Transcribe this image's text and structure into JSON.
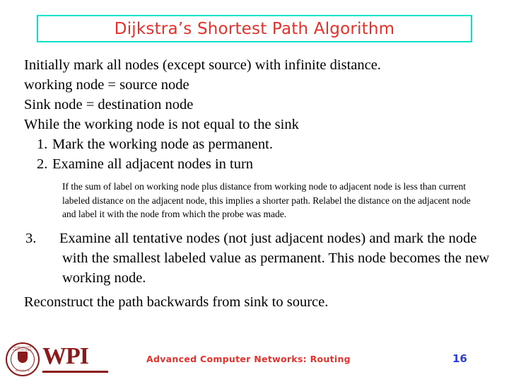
{
  "slide": {
    "title": "Dijkstra’s Shortest Path Algorithm",
    "lines": [
      "Initially mark all nodes (except source) with infinite distance.",
      "working node = source node",
      "Sink node  = destination node",
      "While the working node is not equal to the sink"
    ],
    "steps": [
      {
        "num": "1.",
        "text": "Mark the working node as permanent."
      },
      {
        "num": "2.",
        "text": "Examine all adjacent nodes in turn"
      }
    ],
    "note": "If the sum of label on working node plus distance from working node to adjacent node is less than current labeled distance on the adjacent node, this implies a shorter path. Relabel the distance on the adjacent node and label it with the node from which the probe was made.",
    "step3": {
      "num": "3.",
      "text": "Examine all tentative nodes (not just adjacent nodes) and mark the node with the smallest labeled value as permanent. This node becomes the new working node."
    },
    "closing": "Reconstruct the path backwards from sink to source."
  },
  "footer": {
    "text": "Advanced Computer Networks: Routing",
    "page_number": "16"
  },
  "logo": {
    "wordmark": "WPI",
    "seal_top": "WORCESTER POLYTECHNIC",
    "seal_bottom": "INSTITUTE"
  },
  "colors": {
    "title_text": "#e8302a",
    "title_border": "#00e5c9",
    "footer_text": "#e8302a",
    "page_number": "#2b3fd4",
    "logo": "#8b1a1a",
    "body_text": "#000000"
  }
}
